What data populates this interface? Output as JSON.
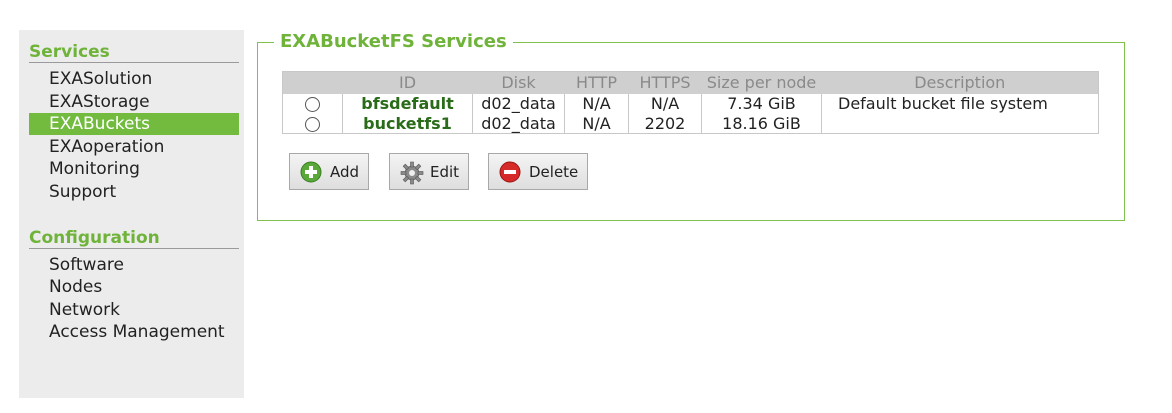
{
  "sidebar": {
    "services_heading": "Services",
    "services_items": [
      "EXASolution",
      "EXAStorage",
      "EXABuckets",
      "EXAoperation",
      "Monitoring",
      "Support"
    ],
    "active_item": "EXABuckets",
    "configuration_heading": "Configuration",
    "configuration_items": [
      "Software",
      "Nodes",
      "Network",
      "Access Management"
    ]
  },
  "panel": {
    "title": "EXABucketFS Services",
    "columns": [
      "",
      "ID",
      "Disk",
      "HTTP",
      "HTTPS",
      "Size per node",
      "Description"
    ],
    "rows": [
      {
        "id": "bfsdefault",
        "disk": "d02_data",
        "http": "N/A",
        "https": "N/A",
        "size": "7.34 GiB",
        "description": "Default bucket file system"
      },
      {
        "id": "bucketfs1",
        "disk": "d02_data",
        "http": "N/A",
        "https": "2202",
        "size": "18.16 GiB",
        "description": ""
      }
    ],
    "buttons": {
      "add": "Add",
      "edit": "Edit",
      "delete": "Delete"
    }
  },
  "colors": {
    "accent": "#6fb33a",
    "active_bg": "#72bb3f",
    "id_text": "#2a6b1a"
  },
  "icons": {
    "add": "plus-circle-icon",
    "edit": "gear-icon",
    "delete": "minus-circle-icon"
  }
}
